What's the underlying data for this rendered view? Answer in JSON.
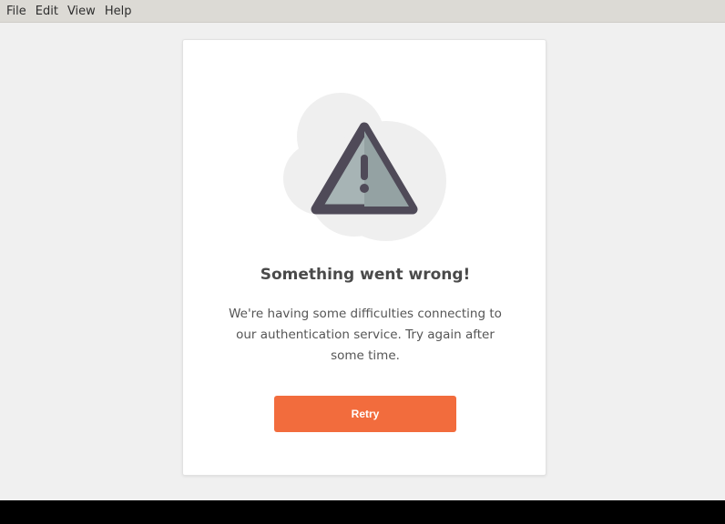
{
  "menubar": {
    "items": [
      "File",
      "Edit",
      "View",
      "Help"
    ]
  },
  "error": {
    "icon": "warning-triangle-icon",
    "title": "Something went wrong!",
    "message": "We're having some difficulties connecting to our authentication service. Try again after some time.",
    "retry_label": "Retry"
  },
  "colors": {
    "accent": "#f26c3d",
    "menubar": "#dcdad5",
    "background": "#f0f0f0"
  }
}
